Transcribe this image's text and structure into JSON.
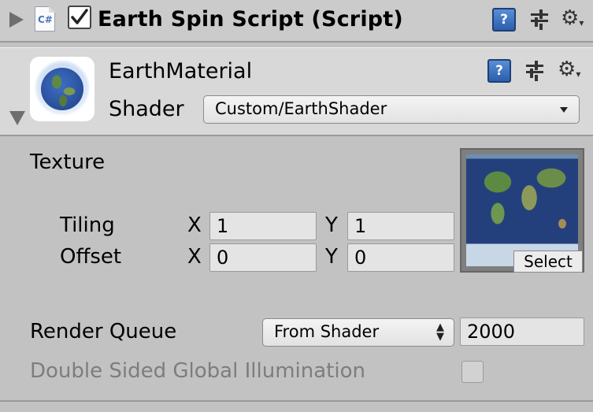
{
  "script_component": {
    "title": "Earth Spin Script (Script)",
    "file_icon_label": "C#",
    "enabled": true,
    "icons": [
      "foldout-arrow-icon",
      "cs-script-icon",
      "help-icon",
      "preset-icon",
      "gear-icon"
    ]
  },
  "material": {
    "name": "EarthMaterial",
    "shader_label": "Shader",
    "shader_value": "Custom/EarthShader",
    "help_label": "?"
  },
  "properties": {
    "texture_label": "Texture",
    "tiling_label": "Tiling",
    "offset_label": "Offset",
    "x_label": "X",
    "y_label": "Y",
    "tiling_x": "1",
    "tiling_y": "1",
    "offset_x": "0",
    "offset_y": "0",
    "select_label": "Select",
    "render_queue_label": "Render Queue",
    "render_queue_mode": "From Shader",
    "render_queue_value": "2000",
    "dsgi_label": "Double Sided Global Illumination",
    "dsgi_checked": false
  },
  "colors": {
    "background": "#c2c2c2",
    "header": "#cbcbcb",
    "help_blue": "#3a6fc0",
    "disabled_text": "#7d7d7d"
  }
}
